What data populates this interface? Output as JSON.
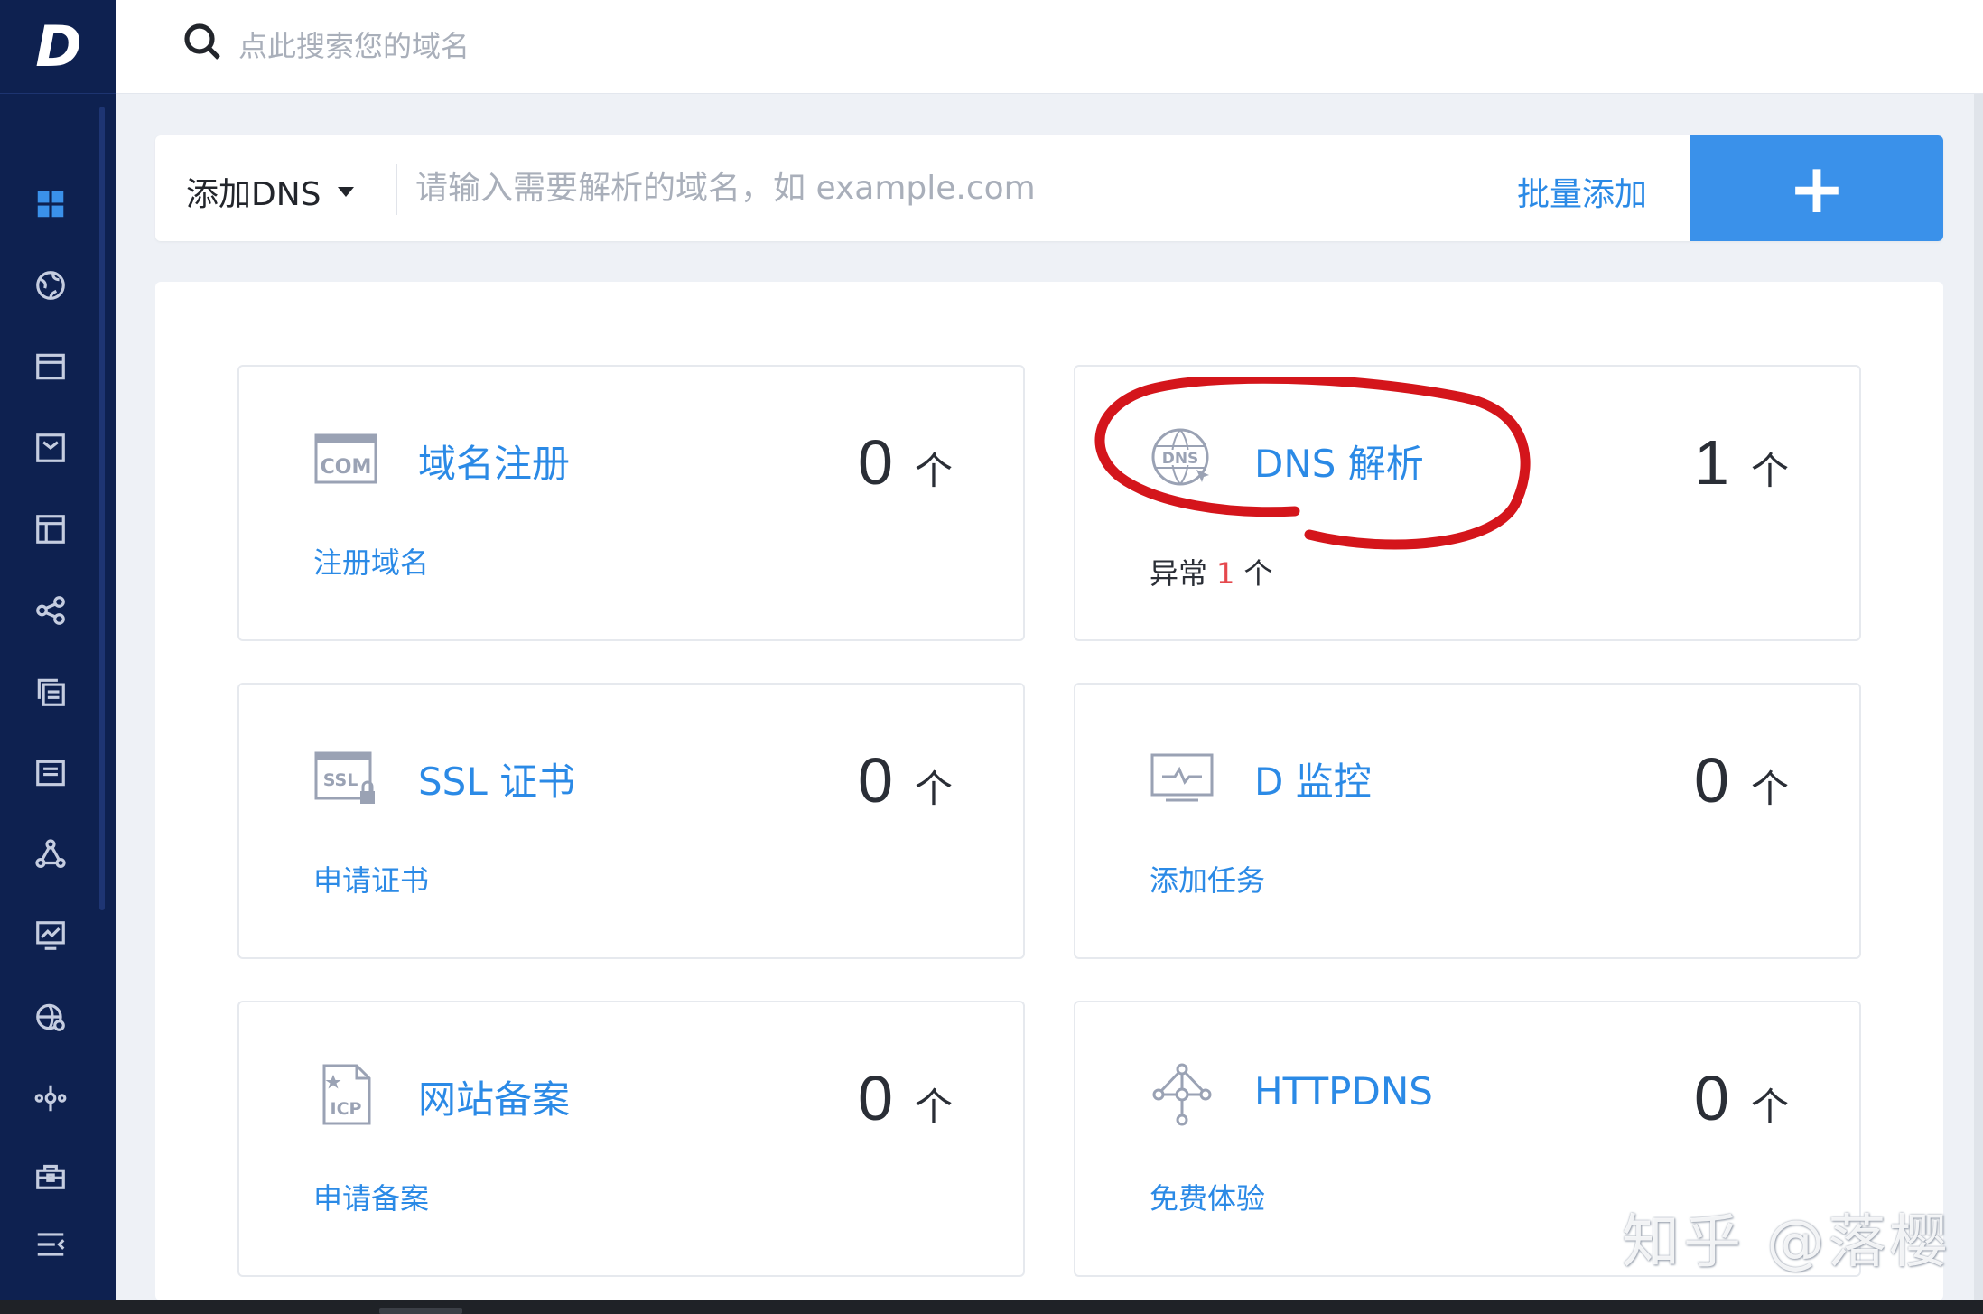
{
  "app": {
    "logo_letter": "D"
  },
  "header": {
    "search_placeholder": "点此搜索您的域名"
  },
  "add_bar": {
    "dropdown_label": "添加DNS",
    "input_placeholder": "请输入需要解析的域名，如 example.com",
    "bulk_label": "批量添加",
    "add_button_label": "+"
  },
  "sidebar": {
    "icons": [
      "dashboard-icon",
      "globe-icon",
      "browser-window-icon",
      "checkbox-icon",
      "layout-icon",
      "share-icon",
      "copy-icon",
      "list-icon",
      "triangle-nodes-icon",
      "monitor-chart-icon",
      "globe-gear-icon",
      "node-branch-icon",
      "certificate-icon",
      "menu-collapse-icon"
    ],
    "accent_color": "#2b8ae6"
  },
  "cards": [
    {
      "icon": "com-icon",
      "icon_text": "COM",
      "title": "域名注册",
      "count": "0",
      "unit": "个",
      "link": "注册域名"
    },
    {
      "icon": "dns-icon",
      "icon_text": "DNS",
      "title": "DNS 解析",
      "count": "1",
      "unit": "个",
      "status_label": "异常",
      "status_count": "1",
      "status_unit": "个"
    },
    {
      "icon": "ssl-icon",
      "icon_text": "SSL",
      "title": "SSL 证书",
      "count": "0",
      "unit": "个",
      "link": "申请证书"
    },
    {
      "icon": "monitor-icon",
      "title": "D 监控",
      "count": "0",
      "unit": "个",
      "link": "添加任务"
    },
    {
      "icon": "icp-icon",
      "icon_text": "ICP",
      "title": "网站备案",
      "count": "0",
      "unit": "个",
      "link": "申请备案"
    },
    {
      "icon": "httpdns-icon",
      "title": "HTTPDNS",
      "count": "0",
      "unit": "个",
      "link": "免费体验"
    }
  ],
  "watermark": "知乎 @落樱",
  "colors": {
    "sidebar_bg": "#0e2150",
    "link_blue": "#2b8ae6",
    "button_blue": "#3a91ea",
    "error_red": "#e5484d",
    "annotation_red": "#d4151b"
  }
}
